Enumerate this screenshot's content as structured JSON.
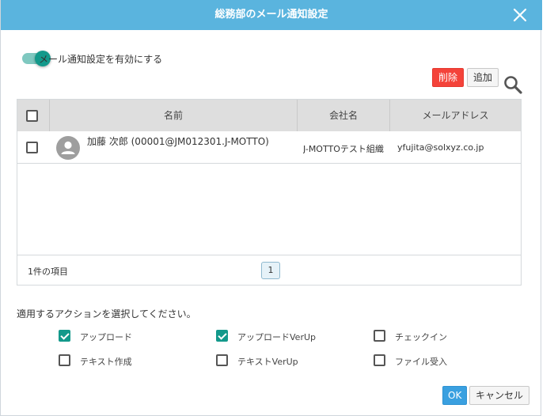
{
  "dialog": {
    "title": "総務部のメール通知設定",
    "title_bar_color": "#5ab4de"
  },
  "notify_toggle": {
    "label": "メール通知設定を有効にする",
    "enabled": true,
    "color": "#13998b"
  },
  "toolbar": {
    "delete_label": "削除",
    "add_label": "追加",
    "delete_color": "#f4433a",
    "search_icon": "search-icon"
  },
  "table": {
    "columns": [
      "名前",
      "会社名",
      "メールアドレス"
    ],
    "header_checked": false,
    "rows": [
      {
        "checked": false,
        "avatar_icon": "person-icon",
        "name": "加藤 次郎 (00001@JM012301.J-MOTTO)",
        "company": "J-MOTTOテスト組織",
        "email": "yfujita@solxyz.co.jp"
      }
    ],
    "footer": {
      "count_text": "1件の項目",
      "current_page": "1"
    }
  },
  "actions": {
    "prompt": "適用するアクションを選択してください。",
    "items": [
      {
        "label": "アップロード",
        "checked": true
      },
      {
        "label": "アップロードVerUp",
        "checked": true
      },
      {
        "label": "チェックイン",
        "checked": false
      },
      {
        "label": "テキスト作成",
        "checked": false
      },
      {
        "label": "テキストVerUp",
        "checked": false
      },
      {
        "label": "ファイル受入",
        "checked": false
      }
    ]
  },
  "footer_buttons": {
    "ok_label": "OK",
    "cancel_label": "キャンセル",
    "ok_color": "#3aa0e0"
  }
}
